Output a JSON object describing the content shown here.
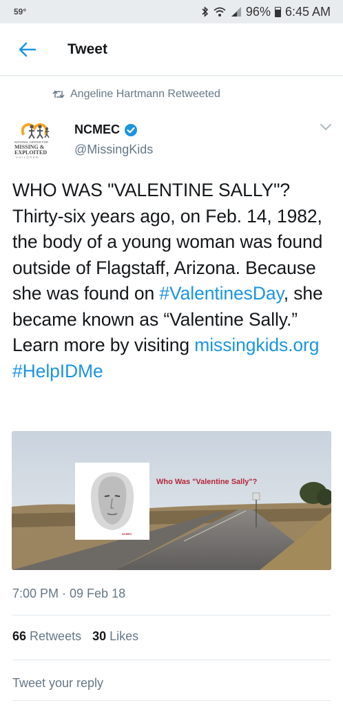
{
  "status_bar": {
    "temperature": "59°",
    "battery": "96%",
    "time": "6:45 AM",
    "icons": [
      "bluetooth-icon",
      "wifi-icon",
      "signal-icon",
      "battery-icon"
    ]
  },
  "header": {
    "title": "Tweet",
    "back_icon": "arrow-left-icon"
  },
  "retweet": {
    "text": "Angeline Hartmann Retweeted",
    "icon": "retweet-icon"
  },
  "author": {
    "name": "NCMEC",
    "handle": "@MissingKids",
    "verified": true,
    "avatar_text": {
      "line1": "NATIONAL CENTER FOR",
      "line2": "MISSING &",
      "line3": "EXPLOITED",
      "line4": "CHILDREN"
    }
  },
  "tweet": {
    "t1": "WHO WAS \"VALENTINE SALLY\"? Thirty-six years ago, on Feb. 14, 1982, the body of a young woman was found outside of Flagstaff, Arizona. Because she was found on ",
    "h1": "#ValentinesDay",
    "t2": ", she became known as “Valentine Sally.” Learn more by visiting ",
    "link": "missingkids.org",
    "t3": " ",
    "h2": "#HelpIDMe"
  },
  "media": {
    "caption": "Who Was \"Valentine Sally\"?"
  },
  "meta": {
    "timestamp": "7:00 PM · 09 Feb 18"
  },
  "stats": {
    "retweets_count": "66",
    "retweets_label": "Retweets",
    "likes_count": "30",
    "likes_label": "Likes"
  },
  "reply": {
    "placeholder": "Tweet your reply"
  },
  "colors": {
    "link": "#1b95e0",
    "secondary_text": "#657786",
    "primary_text": "#14171a",
    "status_bar": "#e9ecef"
  }
}
